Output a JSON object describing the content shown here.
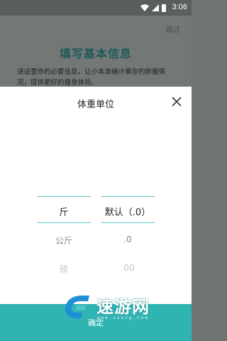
{
  "status_bar": {
    "time": "3:06",
    "icons": [
      "wifi-icon",
      "signal-icon",
      "battery-icon"
    ]
  },
  "background": {
    "skip_label": "跳过",
    "title": "填写基本信息",
    "description": "请设置你的必要信息，让小本准确计算你的胖瘦情况，提供更好的瘦身体验。"
  },
  "sheet": {
    "title": "体重单位",
    "close_icon": "close-icon",
    "unit_picker": {
      "selected": "斤",
      "below": [
        "公斤",
        "磅"
      ]
    },
    "decimal_picker": {
      "selected": "默认（.0）",
      "below": [
        ".0",
        ".00"
      ]
    },
    "confirm_label": "确定"
  },
  "watermark": {
    "name": "速游网",
    "url": "www.sssrg.com"
  },
  "colors": {
    "accent": "#2fb4b2",
    "picker_line": "#5cc8c6",
    "overlay": "#6f7472",
    "title_teal": "#1e5a58"
  }
}
